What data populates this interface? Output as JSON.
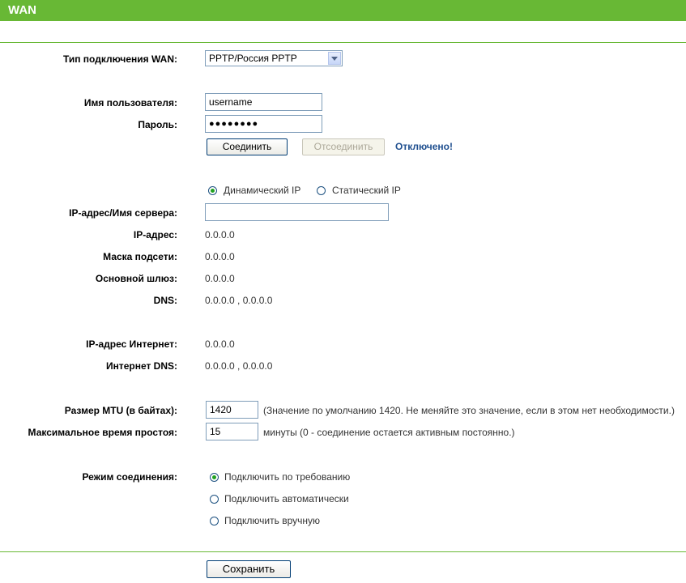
{
  "header": {
    "title": "WAN"
  },
  "connection": {
    "type_label": "Тип подключения WAN:",
    "type_value": "PPTP/Россия PPTP"
  },
  "auth": {
    "username_label": "Имя пользователя:",
    "username_value": "username",
    "password_label": "Пароль:",
    "password_masked": "●●●●●●●●",
    "connect_button": "Соединить",
    "disconnect_button": "Отсоединить",
    "status": "Отключено!"
  },
  "ip_mode": {
    "dynamic_label": "Динамический IP",
    "static_label": "Статический IP",
    "selected": "dynamic"
  },
  "server": {
    "label": "IP-адрес/Имя сервера:",
    "value": ""
  },
  "info": {
    "ip_label": "IP-адрес:",
    "ip_value": "0.0.0.0",
    "mask_label": "Маска подсети:",
    "mask_value": "0.0.0.0",
    "gateway_label": "Основной шлюз:",
    "gateway_value": "0.0.0.0",
    "dns_label": "DNS:",
    "dns_value": "0.0.0.0 , 0.0.0.0",
    "internet_ip_label": "IP-адрес Интернет:",
    "internet_ip_value": "0.0.0.0",
    "internet_dns_label": "Интернет DNS:",
    "internet_dns_value": "0.0.0.0 , 0.0.0.0"
  },
  "mtu": {
    "label": "Размер MTU (в байтах):",
    "value": "1420",
    "hint": "(Значение по умолчанию 1420. Не меняйте это значение, если в этом нет необходимости.)"
  },
  "idle": {
    "label": "Максимальное время простоя:",
    "value": "15",
    "hint": "минуты (0 - соединение остается активным постоянно.)"
  },
  "connect_mode": {
    "label": "Режим соединения:",
    "options": [
      "Подключить по требованию",
      "Подключить автоматически",
      "Подключить вручную"
    ],
    "selected_index": 0
  },
  "save_button": "Сохранить",
  "colors": {
    "header_bg": "#68b835",
    "status": "#1f4f8f",
    "radio_dot": "#21a121"
  }
}
